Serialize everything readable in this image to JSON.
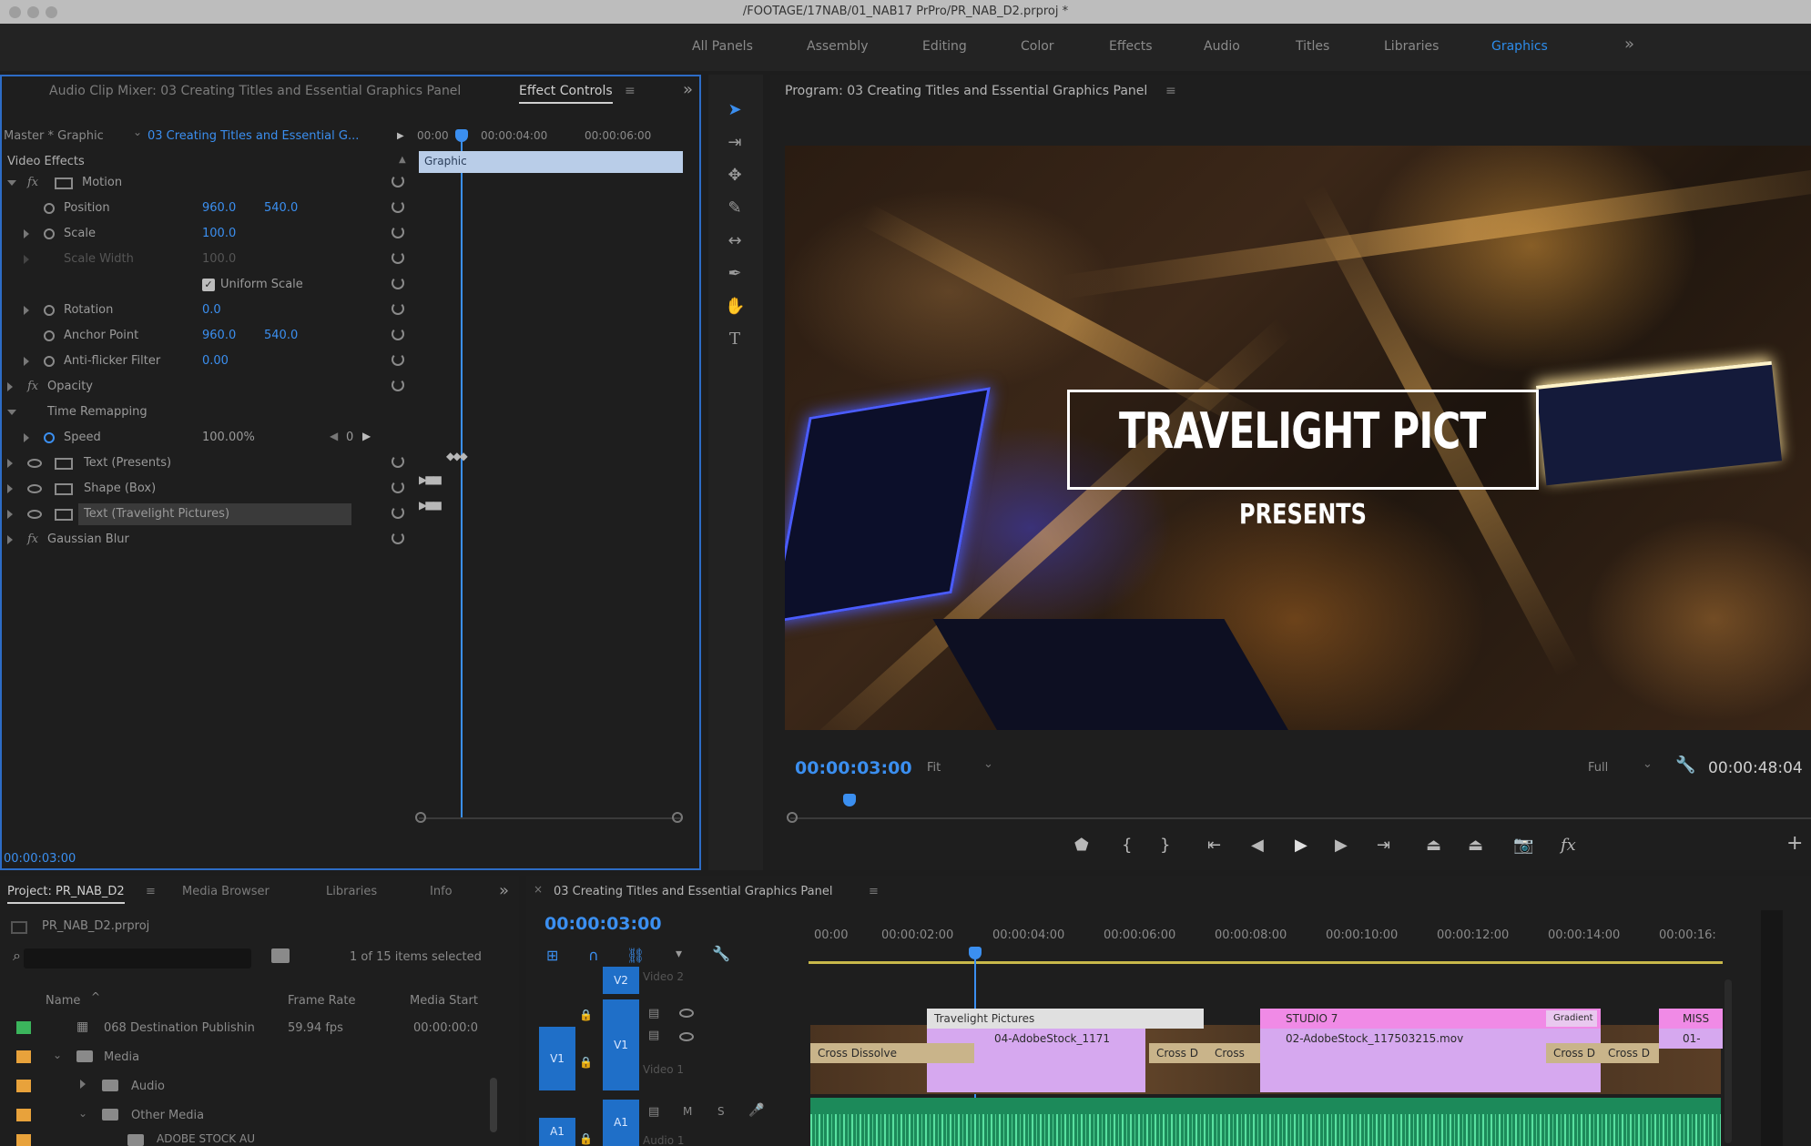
{
  "window": {
    "title": "/FOOTAGE/17NAB/01_NAB17 PrPro/PR_NAB_D2.prproj *"
  },
  "workspaces": [
    "All Panels",
    "Assembly",
    "Editing",
    "Color",
    "Effects",
    "Audio",
    "Titles",
    "Libraries",
    "Graphics"
  ],
  "workspaces_overflow": "»",
  "source_panel": {
    "tabs": [
      "Audio Clip Mixer: 03 Creating Titles and Essential Graphics Panel",
      "Effect Controls"
    ],
    "master_label": "Master * Graphic",
    "clip_label": "03 Creating Titles and Essential G...",
    "ruler": [
      "00:00",
      "00:00:04:00",
      "00:00:06:00"
    ],
    "clip_bar": "Graphic",
    "section": "Video Effects",
    "motion": "Motion",
    "position_label": "Position",
    "position_x": "960.0",
    "position_y": "540.0",
    "scale_label": "Scale",
    "scale_val": "100.0",
    "scale_width_label": "Scale Width",
    "scale_width_val": "100.0",
    "uniform_scale": "Uniform Scale",
    "rotation_label": "Rotation",
    "rotation_val": "0.0",
    "anchor_label": "Anchor Point",
    "anchor_x": "960.0",
    "anchor_y": "540.0",
    "antiflicker_label": "Anti-flicker Filter",
    "antiflicker_val": "0.00",
    "opacity": "Opacity",
    "time_remap": "Time Remapping",
    "speed_label": "Speed",
    "speed_val": "100.00%",
    "speed_num": "0",
    "layer1": "Text (Presents)",
    "layer2": "Shape (Box)",
    "layer3": "Text (Travelight Pictures)",
    "gaussian": "Gaussian Blur",
    "timecode": "00:00:03:00"
  },
  "program": {
    "tab": "Program: 03 Creating Titles and Essential Graphics Panel",
    "title_text": "TRAVELIGHT PICTURES",
    "presents_text": "PRESENTS",
    "timecode": "00:00:03:00",
    "fit": "Fit",
    "quality": "Full",
    "duration": "00:00:48:04"
  },
  "project": {
    "tabs": [
      "Project: PR_NAB_D2",
      "Media Browser",
      "Libraries",
      "Info"
    ],
    "overflow": "»",
    "file": "PR_NAB_D2.prproj",
    "selection": "1 of 15 items selected",
    "col_name": "Name",
    "col_fps": "Frame Rate",
    "col_start": "Media Start",
    "items": [
      {
        "name": "068 Destination Publishin",
        "fps": "59.94 fps",
        "start": "00:00:00:0",
        "color": "#3bb55c"
      },
      {
        "name": "Media",
        "fps": "",
        "start": "",
        "color": "#e8a23b"
      },
      {
        "name": "Audio",
        "fps": "",
        "start": "",
        "color": "#e8a23b"
      },
      {
        "name": "Other Media",
        "fps": "",
        "start": "",
        "color": "#e8a23b"
      },
      {
        "name": "ADOBE STOCK AU",
        "fps": "",
        "start": "",
        "color": "#e8a23b"
      }
    ]
  },
  "timeline": {
    "tab": "03 Creating Titles and Essential Graphics Panel",
    "timecode": "00:00:03:00",
    "ruler": [
      "00:00",
      "00:00:02:00",
      "00:00:04:00",
      "00:00:06:00",
      "00:00:08:00",
      "00:00:10:00",
      "00:00:12:00",
      "00:00:14:00",
      "00:00:16:"
    ],
    "tracks": {
      "v2": "V2",
      "v1": "V1",
      "a1": "A1",
      "video2": "Video 2",
      "video1": "Video 1",
      "audio1": "Audio 1"
    },
    "clips": {
      "graphic": "Travelight Pictures",
      "clip1": "04-AdobeStock_1171",
      "studio": "STUDIO 7",
      "clip2": "02-AdobeStock_117503215.mov",
      "cross1": "Cross Dissolve",
      "cross2": "Cross D",
      "cross3": "Cross",
      "cross4": "Cross D",
      "cross5": "Cross D",
      "cross6": "Cross",
      "gradient": "Gradient",
      "misc": "MISS",
      "end": "01-"
    }
  }
}
